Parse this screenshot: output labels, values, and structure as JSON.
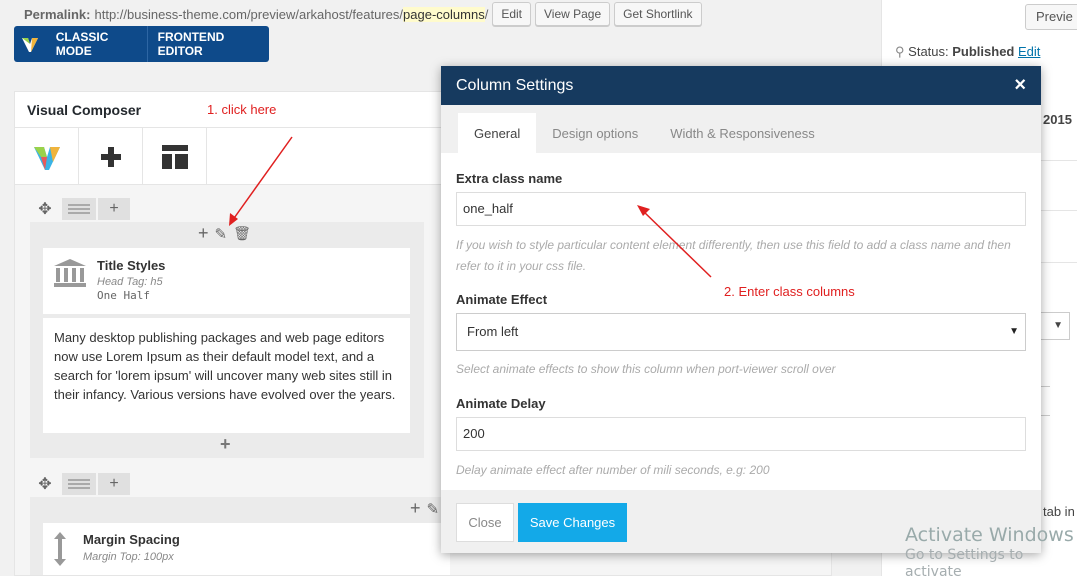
{
  "permalink": {
    "label": "Permalink:",
    "url_base": "http://business-theme.com/preview/arkahost/features/",
    "slug": "page-columns",
    "trail": "/",
    "edit": "Edit",
    "view": "View Page",
    "shortlink": "Get Shortlink"
  },
  "modebar": {
    "classic": "CLASSIC MODE",
    "frontend": "FRONTEND EDITOR"
  },
  "sidebar": {
    "preview": "Previe",
    "status_label": "Status:",
    "status_value": "Published",
    "status_edit": "Edit",
    "year": "2015",
    "tab_text": "tab in"
  },
  "vc": {
    "title": "Visual Composer",
    "annotation_1": "1. click here",
    "element1": {
      "title": "Title Styles",
      "sub": "Head Tag: h5",
      "mono": "One Half"
    },
    "text_block": "Many desktop publishing packages and web page editors now use Lorem Ipsum as their default model text, and a search for 'lorem ipsum' will uncover many web sites still in their infancy. Various versions have evolved over the years.",
    "element2": {
      "title": "Margin Spacing",
      "sub": "Margin Top: 100px"
    }
  },
  "modal": {
    "title": "Column Settings",
    "close_icon": "×",
    "tabs": [
      "General",
      "Design options",
      "Width & Responsiveness"
    ],
    "extra_class": {
      "label": "Extra class name",
      "value": "one_half",
      "help": "If you wish to style particular content element differently, then use this field to add a class name and then refer to it in your css file."
    },
    "annotation_2": "2. Enter class columns",
    "animate_effect": {
      "label": "Animate Effect",
      "value": "From left",
      "help": "Select animate effects to show this column when port-viewer scroll over"
    },
    "animate_delay": {
      "label": "Animate Delay",
      "value": "200",
      "help": "Delay animate effect after number of mili seconds, e.g: 200"
    },
    "close_btn": "Close",
    "save_btn": "Save Changes"
  },
  "watermark": {
    "line1": "Activate Windows",
    "line2": "Go to Settings to activate"
  },
  "colors": {
    "modal_header": "#163a5f",
    "save": "#13a9e8",
    "mode_bar": "#0e4a8a",
    "annotation": "#e02020"
  }
}
